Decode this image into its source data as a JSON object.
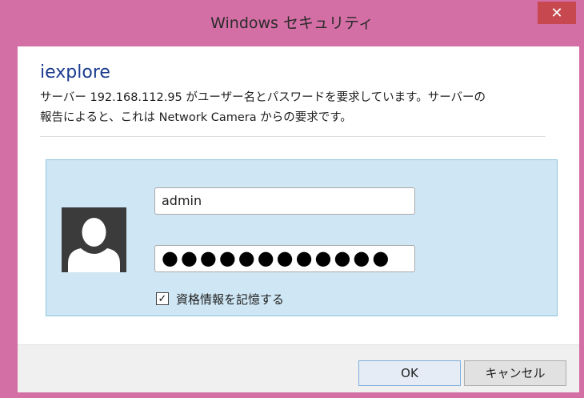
{
  "window": {
    "title": "Windows セキュリティ",
    "close_glyph": "✕"
  },
  "dialog": {
    "app_name": "iexplore",
    "message_line1": "サーバー 192.168.112.95 がユーザー名とパスワードを要求しています。サーバーの",
    "message_line2": "報告によると、これは Network Camera からの要求です。"
  },
  "credentials": {
    "avatar_icon": "user-icon",
    "username_value": "admin",
    "password_masked": "●●●●●●●●●●●●",
    "remember_checked": true,
    "remember_check_glyph": "✓",
    "remember_label": "資格情報を記憶する"
  },
  "footer": {
    "ok_label": "OK",
    "cancel_label": "キャンセル"
  },
  "colors": {
    "frame": "#d46fa6",
    "close_button": "#c7494f",
    "app_name": "#1d3c8f",
    "credential_panel": "#cfe7f4",
    "credential_panel_border": "#8fc3df"
  }
}
